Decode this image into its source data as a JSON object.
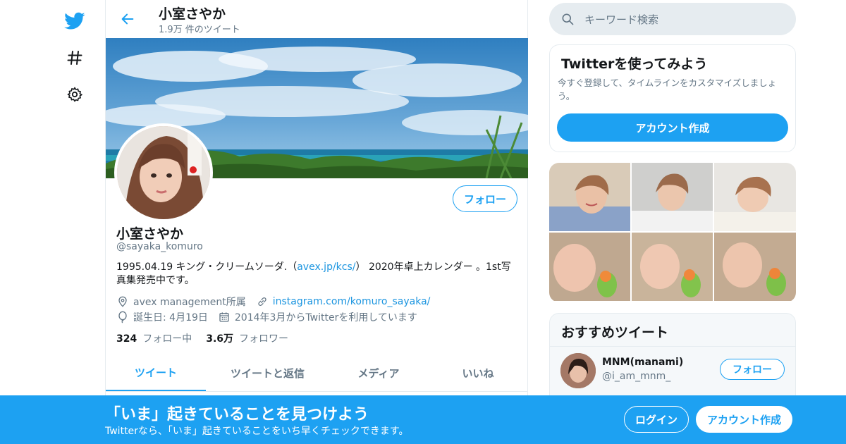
{
  "colors": {
    "accent": "#1da1f2",
    "link": "#1b95e0",
    "muted": "#657786",
    "text": "#14171a"
  },
  "nav": {
    "icons": [
      "twitter-logo-icon",
      "hashtag-icon",
      "gear-icon"
    ]
  },
  "header": {
    "title": "小室さやか",
    "tweet_count": "1.9万 件のツイート"
  },
  "profile": {
    "follow_label": "フォロー",
    "name": "小室さやか",
    "handle": "@sayaka_komuro",
    "bio_before": "1995.04.19 キング・クリームソーダ.（",
    "bio_link": "avex.jp/kcs/",
    "bio_after": "） 2020年卓上カレンダー 。1st写真集発売中です。",
    "location": "avex management所属",
    "website": "instagram.com/komuro_sayaka/",
    "birthday": "誕生日: 4月19日",
    "joined": "2014年3月からTwitterを利用しています",
    "following_count": "324",
    "following_label": "フォロー中",
    "followers_count": "3.6万",
    "followers_label": "フォロワー"
  },
  "tabs": [
    "ツイート",
    "ツイートと返信",
    "メディア",
    "いいね"
  ],
  "search": {
    "placeholder": "キーワード検索"
  },
  "signup_card": {
    "title": "Twitterを使ってみよう",
    "text": "今すぐ登録して、タイムラインをカスタマイズしましょう。",
    "button": "アカウント作成"
  },
  "recommend": {
    "title": "おすすめツイート",
    "items": [
      {
        "name": "MNM(manami)",
        "handle": "@i_am_mnm_",
        "follow": "フォロー"
      }
    ]
  },
  "bottom_bar": {
    "title": "「いま」起きていることを見つけよう",
    "subtitle": "Twitterなら、「いま」起きていることをいち早くチェックできます。",
    "login": "ログイン",
    "signup": "アカウント作成"
  }
}
